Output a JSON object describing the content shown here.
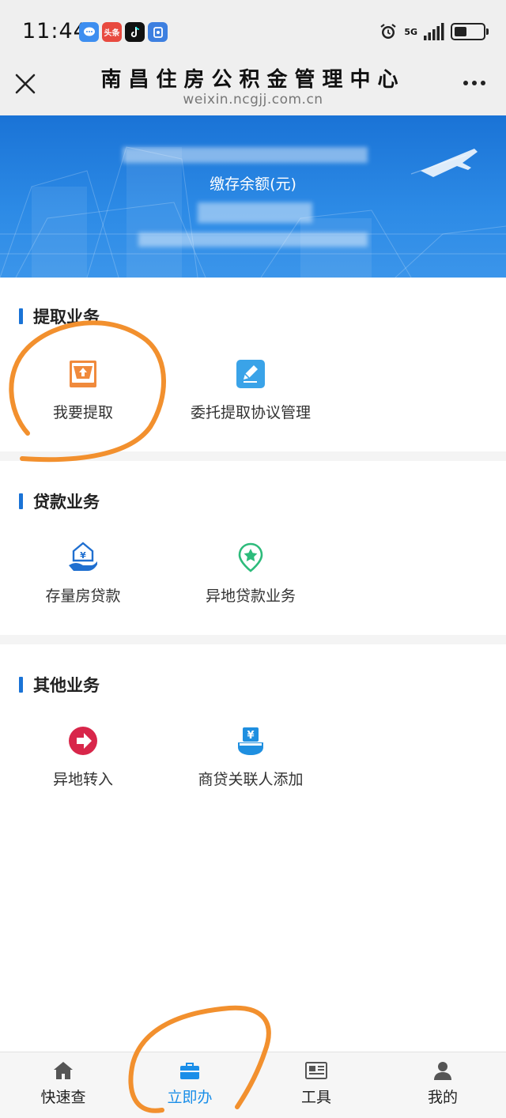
{
  "status_bar": {
    "time": "11:44",
    "apps": [
      {
        "icon": "message-app-icon",
        "label": "",
        "color": "#3d8ef0"
      },
      {
        "icon": "toutiao-app-icon",
        "label": "头条",
        "color": "#e84a3f"
      },
      {
        "icon": "tiktok-app-icon",
        "label": "",
        "color": "#111111"
      },
      {
        "icon": "shield-app-icon",
        "label": "",
        "color": "#3d7fe0"
      }
    ],
    "network": "5G",
    "battery_level": 0.45
  },
  "titlebar": {
    "title": "南昌住房公积金管理中心",
    "url": "weixin.ncgjj.com.cn"
  },
  "banner": {
    "balance_label": "缴存余额(元)",
    "accent": "#1a73d6"
  },
  "sections": [
    {
      "title": "提取业务",
      "items": [
        {
          "label": "我要提取",
          "icon": "withdraw-tray-icon",
          "color": "#f08a3c"
        },
        {
          "label": "委托提取协议管理",
          "icon": "edit-pencil-icon",
          "color": "#3aa3e8"
        }
      ]
    },
    {
      "title": "贷款业务",
      "items": [
        {
          "label": "存量房贷款",
          "icon": "house-loan-hand-icon",
          "color": "#1f6fd0"
        },
        {
          "label": "异地贷款业务",
          "icon": "location-star-icon",
          "color": "#2dbb7b"
        }
      ]
    },
    {
      "title": "其他业务",
      "items": [
        {
          "label": "异地转入",
          "icon": "arrow-right-circle-icon",
          "color": "#d8264a"
        },
        {
          "label": "商贷关联人添加",
          "icon": "yuan-hand-icon",
          "color": "#1f8fe0"
        }
      ]
    }
  ],
  "bottom_nav": [
    {
      "label": "快速查",
      "icon": "home-icon",
      "active": false
    },
    {
      "label": "立即办",
      "icon": "briefcase-icon",
      "active": true
    },
    {
      "label": "工具",
      "icon": "newspaper-icon",
      "active": false
    },
    {
      "label": "我的",
      "icon": "user-icon",
      "active": false
    }
  ],
  "colors": {
    "active_nav": "#1a8ee8",
    "section_bar": "#1a73d6",
    "annotation": "#f2902e"
  }
}
